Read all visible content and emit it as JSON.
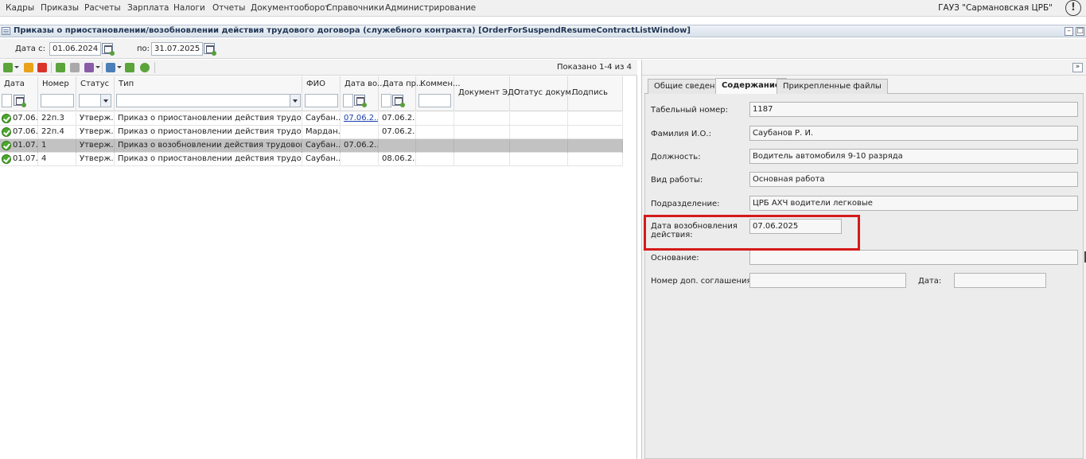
{
  "menu": {
    "items": [
      "Кадры",
      "Приказы",
      "Расчеты",
      "Зарплата",
      "Налоги",
      "Отчеты",
      "Документооборот",
      "Справочники",
      "Администрирование"
    ],
    "org": "ГАУЗ \"Сармановская ЦРБ\"",
    "alert_glyph": "!"
  },
  "window": {
    "title": "Приказы о приостановлении/возобновлении действия трудового договора (служебного контракта) [OrderForSuspendResumeContractListWindow]",
    "min_glyph": "–",
    "max_glyph": "□"
  },
  "filter": {
    "from_label": "Дата с:",
    "from_value": "01.06.2024",
    "to_label": "по:",
    "to_value": "31.07.2025"
  },
  "toolbar": {
    "shown_text": "Показано 1-4 из 4",
    "icons": [
      "add-icon",
      "edit-icon",
      "delete-icon",
      "approve-icon",
      "unapprove-icon",
      "actions-icon",
      "print-icon",
      "export-icon",
      "refresh-icon"
    ],
    "colors": {
      "add": "#5aa43a",
      "edit": "#e9a21a",
      "delete": "#d9342b",
      "approve": "#5aa43a",
      "neutral": "#a9a9a9",
      "purple": "#8a5ca8",
      "blue": "#4a7fb8"
    }
  },
  "grid": {
    "columns": [
      "Дата",
      "Номер",
      "Статус",
      "Тип",
      "ФИО",
      "Дата во...",
      "Дата пр...",
      "Коммен...",
      "Документ ЭДО",
      "Статус докум...",
      "Подпись"
    ],
    "rows": [
      {
        "date": "07.06...",
        "number": "22п.3",
        "status": "Утверж...",
        "type": "Приказ о приостановлении действия трудового догов...",
        "fio": "Саубан...",
        "resume_date": "07.06.2...",
        "suspend_date": "07.06.2...",
        "comment": "",
        "edo": "",
        "doc_status": "",
        "sign": ""
      },
      {
        "date": "07.06...",
        "number": "22п.4",
        "status": "Утверж...",
        "type": "Приказ о приостановлении действия трудового догов...",
        "fio": "Мардан...",
        "resume_date": "",
        "suspend_date": "07.06.2...",
        "comment": "",
        "edo": "",
        "doc_status": "",
        "sign": ""
      },
      {
        "date": "01.07...",
        "number": "1",
        "status": "Утверж...",
        "type": "Приказ о возобновлении действия трудового договор...",
        "fio": "Саубан...",
        "resume_date": "07.06.2...",
        "suspend_date": "",
        "comment": "",
        "edo": "",
        "doc_status": "",
        "sign": ""
      },
      {
        "date": "01.07...",
        "number": "4",
        "status": "Утверж...",
        "type": "Приказ о приостановлении действия трудового догов...",
        "fio": "Саубан...",
        "resume_date": "",
        "suspend_date": "08.06.2...",
        "comment": "",
        "edo": "",
        "doc_status": "",
        "sign": ""
      }
    ],
    "selected_row": 2
  },
  "details": {
    "collapse_glyph": "»",
    "tabs": [
      "Общие сведения",
      "Содержание",
      "Прикрепленные файлы"
    ],
    "active_tab": 1,
    "fields": {
      "tab_number_label": "Табельный номер:",
      "tab_number": "1187",
      "fio_label": "Фамилия И.О.:",
      "fio": "Саубанов Р. И.",
      "position_label": "Должность:",
      "position": "Водитель автомобиля 9-10 разряда",
      "work_type_label": "Вид работы:",
      "work_type": "Основная работа",
      "department_label": "Подразделение:",
      "department": "ЦРБ АХЧ водители легковые",
      "resume_date_label_1": "Дата возобновления",
      "resume_date_label_2": "действия:",
      "resume_date": "07.06.2025",
      "basis_label": "Основание:",
      "basis": "",
      "agreement_label": "Номер доп. соглашения:",
      "agreement": "",
      "date_label": "Дата:",
      "date": ""
    },
    "highlight_color": "#d51a1a"
  }
}
